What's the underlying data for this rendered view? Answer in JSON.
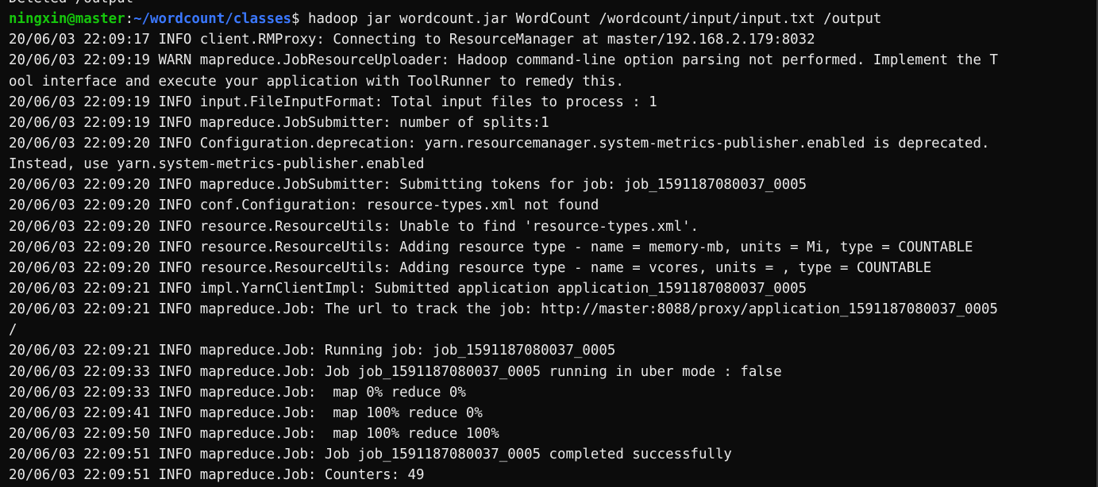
{
  "prompt": {
    "user_host": "ningxin@master",
    "separator": ":",
    "path": "~/wordcount/classes",
    "symbol": "$ ",
    "command": "hadoop jar wordcount.jar WordCount /wordcount/input/input.txt /output"
  },
  "previous_line": "Deleted /output",
  "log_lines": [
    "20/06/03 22:09:17 INFO client.RMProxy: Connecting to ResourceManager at master/192.168.2.179:8032",
    "20/06/03 22:09:19 WARN mapreduce.JobResourceUploader: Hadoop command-line option parsing not performed. Implement the T",
    "ool interface and execute your application with ToolRunner to remedy this.",
    "20/06/03 22:09:19 INFO input.FileInputFormat: Total input files to process : 1",
    "20/06/03 22:09:19 INFO mapreduce.JobSubmitter: number of splits:1",
    "20/06/03 22:09:20 INFO Configuration.deprecation: yarn.resourcemanager.system-metrics-publisher.enabled is deprecated.",
    "Instead, use yarn.system-metrics-publisher.enabled",
    "20/06/03 22:09:20 INFO mapreduce.JobSubmitter: Submitting tokens for job: job_1591187080037_0005",
    "20/06/03 22:09:20 INFO conf.Configuration: resource-types.xml not found",
    "20/06/03 22:09:20 INFO resource.ResourceUtils: Unable to find 'resource-types.xml'.",
    "20/06/03 22:09:20 INFO resource.ResourceUtils: Adding resource type - name = memory-mb, units = Mi, type = COUNTABLE",
    "20/06/03 22:09:20 INFO resource.ResourceUtils: Adding resource type - name = vcores, units = , type = COUNTABLE",
    "20/06/03 22:09:21 INFO impl.YarnClientImpl: Submitted application application_1591187080037_0005",
    "20/06/03 22:09:21 INFO mapreduce.Job: The url to track the job: http://master:8088/proxy/application_1591187080037_0005",
    "/",
    "20/06/03 22:09:21 INFO mapreduce.Job: Running job: job_1591187080037_0005",
    "20/06/03 22:09:33 INFO mapreduce.Job: Job job_1591187080037_0005 running in uber mode : false",
    "20/06/03 22:09:33 INFO mapreduce.Job:  map 0% reduce 0%",
    "20/06/03 22:09:41 INFO mapreduce.Job:  map 100% reduce 0%",
    "20/06/03 22:09:50 INFO mapreduce.Job:  map 100% reduce 100%",
    "20/06/03 22:09:51 INFO mapreduce.Job: Job job_1591187080037_0005 completed successfully",
    "20/06/03 22:09:51 INFO mapreduce.Job: Counters: 49"
  ],
  "colors": {
    "background": "#0c0c0c",
    "text": "#e8e8e8",
    "prompt_user": "#16c60c",
    "prompt_path": "#3b78ff"
  }
}
